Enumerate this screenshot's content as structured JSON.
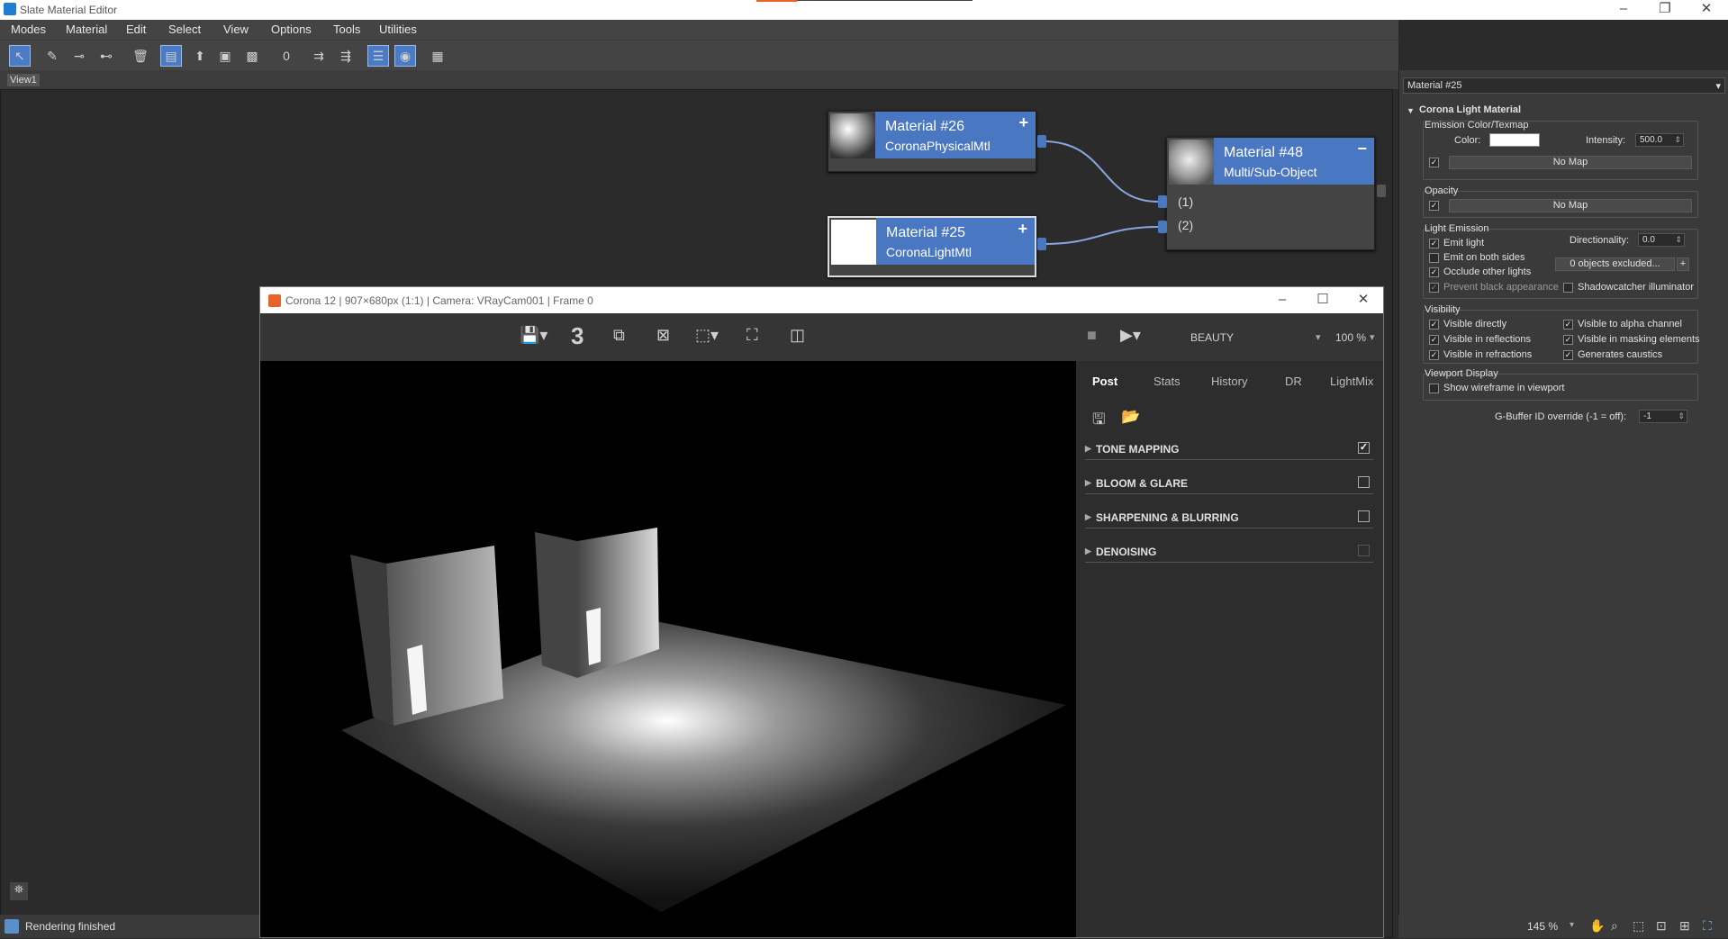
{
  "app": {
    "title": "Slate Material Editor"
  },
  "menu": [
    "Modes",
    "Material",
    "Edit",
    "Select",
    "View",
    "Options",
    "Tools",
    "Utilities"
  ],
  "view_tab": "View1",
  "nodes": [
    {
      "name": "Material #26",
      "type": "CoronaPhysicalMtl",
      "action": "+"
    },
    {
      "name": "Material #25",
      "type": "CoronaLightMtl",
      "action": "+"
    },
    {
      "name": "Material #48",
      "type": "Multi/Sub-Object",
      "action": "−",
      "slots": [
        "(1)",
        "(2)"
      ]
    }
  ],
  "render_window": {
    "title": "Corona 12 | 907×680px (1:1) | Camera: VRayCam001 | Frame 0",
    "history_count": "3",
    "pass": "BEAUTY",
    "zoom": "100 %",
    "tabs": [
      "Post",
      "Stats",
      "History",
      "DR",
      "LightMix"
    ],
    "sections": [
      {
        "label": "TONE MAPPING",
        "checked": true
      },
      {
        "label": "BLOOM & GLARE",
        "checked": false
      },
      {
        "label": "SHARPENING & BLURRING",
        "checked": false
      },
      {
        "label": "DENOISING",
        "checked": false
      }
    ]
  },
  "status": {
    "text": "Rendering finished"
  },
  "props": {
    "material": "Material #25",
    "rollout": "Corona Light Material",
    "emission_group": "Emission Color/Texmap",
    "color_label": "Color:",
    "intensity_label": "Intensity:",
    "intensity": "500.0",
    "no_map": "No Map",
    "opacity_group": "Opacity",
    "light_emission_group": "Light Emission",
    "emit_light": "Emit light",
    "directionality_label": "Directionality:",
    "directionality": "0.0",
    "emit_both": "Emit on both sides",
    "excluded": "0 objects excluded...",
    "plus": "+",
    "occlude": "Occlude other lights",
    "prevent": "Prevent black appearance",
    "shadowcatcher": "Shadowcatcher illuminator",
    "visibility_group": "Visibility",
    "vis_directly": "Visible directly",
    "vis_alpha": "Visible to alpha channel",
    "vis_reflections": "Visible in reflections",
    "vis_masking": "Visible in masking elements",
    "vis_refractions": "Visible in refractions",
    "caustics": "Generates caustics",
    "viewport_group": "Viewport Display",
    "wireframe": "Show wireframe in viewport",
    "gbuffer_label": "G-Buffer ID override (-1 = off):",
    "gbuffer": "-1"
  },
  "zoom_level": "145 %",
  "colors": {
    "accent": "#4a77c2",
    "node_header": "#4a77c2",
    "corona": "#e8622a"
  }
}
